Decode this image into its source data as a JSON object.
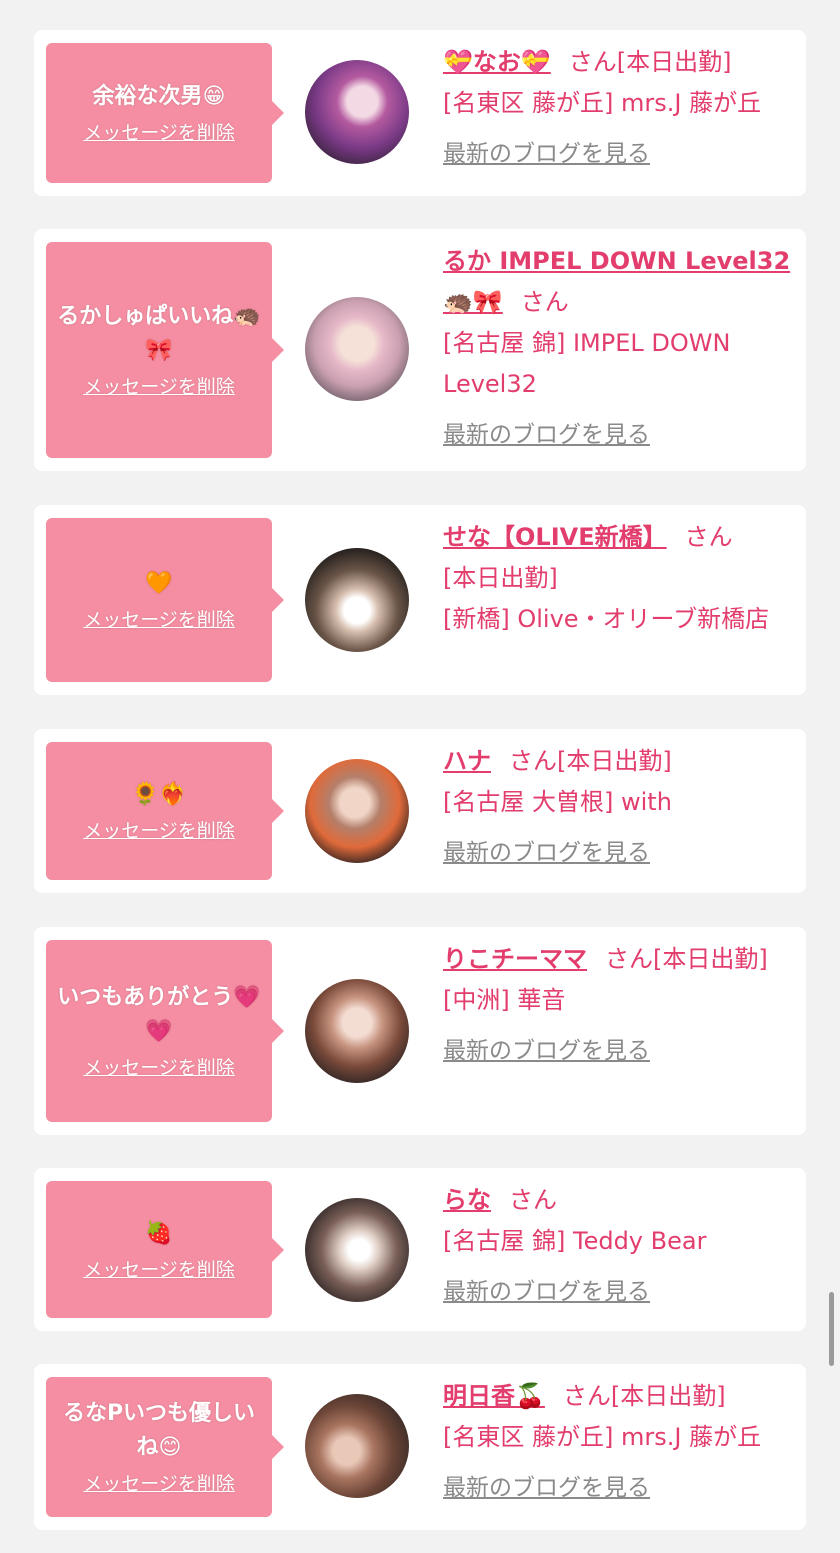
{
  "common": {
    "delete_label": "メッセージを削除",
    "blog_label": "最新のブログを見る",
    "san": "さん"
  },
  "cards": [
    {
      "message": "余裕な次男😁",
      "name": "💝なお💝",
      "attendance": "[本日出勤]",
      "shop": "[名東区 藤が丘] mrs.J 藤が丘",
      "avatar": "avatar-nao"
    },
    {
      "message": "るかしゅぱいいね🦔🎀",
      "name": "るか IMPEL DOWN Level32🦔🎀",
      "attendance": "",
      "shop": "[名古屋 錦] IMPEL DOWN Level32",
      "avatar": "avatar-ruka"
    },
    {
      "message": "🧡",
      "name": "せな【OLIVE新橋】",
      "attendance": "[本日出勤]",
      "shop": "[新橋] Olive・オリーブ新橋店",
      "avatar": "avatar-sena"
    },
    {
      "message": "🌻❤️‍🔥",
      "name": "ハナ",
      "attendance": "[本日出勤]",
      "shop": "[名古屋 大曽根] with",
      "avatar": "avatar-hana"
    },
    {
      "message": "いつもありがとう💗💗",
      "name": "りこチーママ",
      "attendance": "[本日出勤]",
      "shop": "[中洲] 華音",
      "avatar": "avatar-riko"
    },
    {
      "message": "🍓",
      "name": "らな",
      "attendance": "",
      "shop": "[名古屋 錦] Teddy Bear",
      "avatar": "avatar-rana"
    },
    {
      "message": "るなPいつも優しいね😊",
      "name": "明日香🍒",
      "attendance": "[本日出勤]",
      "shop": "[名東区 藤が丘] mrs.J 藤が丘",
      "avatar": "avatar-asuka"
    }
  ],
  "colors": {
    "accent": "#e23d6c",
    "bubble": "#f58ea2",
    "background": "#f2f2f2"
  }
}
